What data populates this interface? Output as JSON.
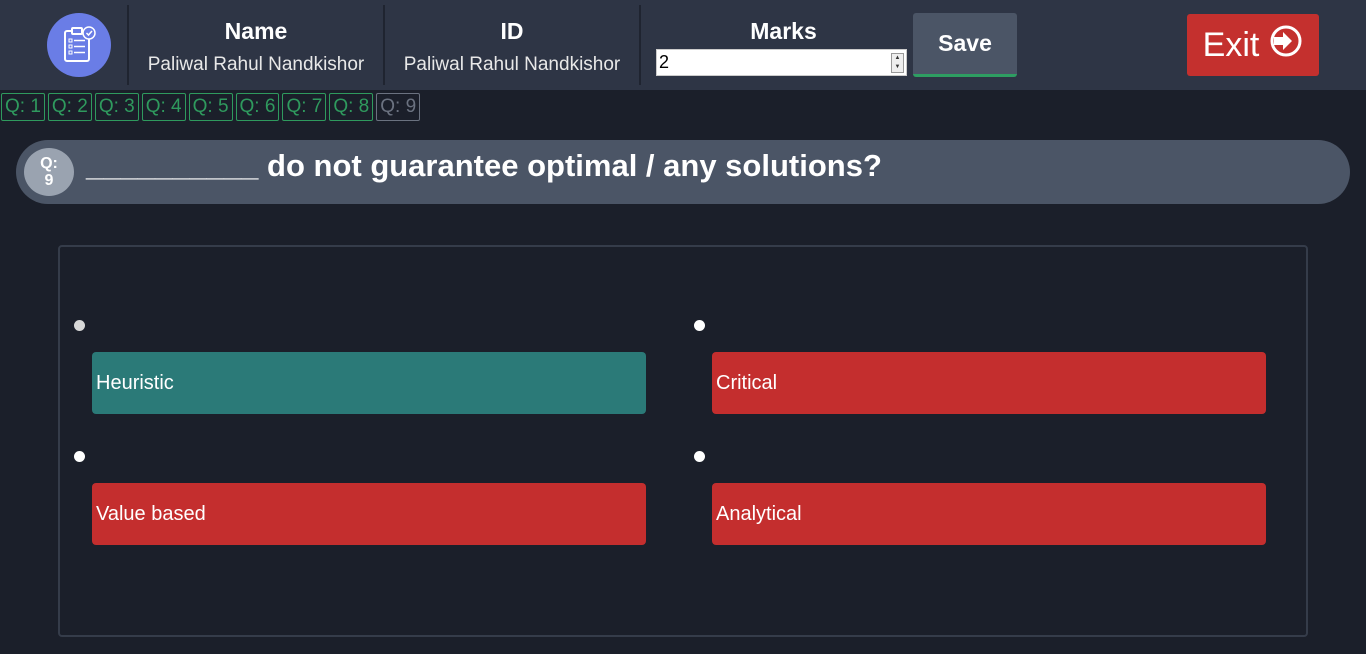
{
  "header": {
    "name_label": "Name",
    "name_value": "Paliwal Rahul Nandkishor",
    "id_label": "ID",
    "id_value": "Paliwal Rahul Nandkishor",
    "marks_label": "Marks",
    "marks_value": "2",
    "save_label": "Save",
    "exit_label": "Exit"
  },
  "nav": {
    "questions": [
      "Q: 1",
      "Q: 2",
      "Q: 3",
      "Q: 4",
      "Q: 5",
      "Q: 6",
      "Q: 7",
      "Q: 8",
      "Q: 9"
    ],
    "current": "Q: 9"
  },
  "question": {
    "badge_prefix": "Q:",
    "badge_number": "9",
    "text": "__________ do not guarantee optimal / any solutions?"
  },
  "options": [
    {
      "label": "Heuristic",
      "state": "correct"
    },
    {
      "label": "Critical",
      "state": "wrong"
    },
    {
      "label": "Value based",
      "state": "wrong"
    },
    {
      "label": "Analytical",
      "state": "wrong"
    }
  ],
  "colors": {
    "background": "#1b1f2a",
    "topbar": "#2e3545",
    "accent_green": "#2f9a5e",
    "correct_option": "#2b7a78",
    "wrong_option": "#c42e2e",
    "exit_button": "#c4302e",
    "logo": "#6a7de6"
  },
  "icons": {
    "logo": "quiz-clipboard-icon",
    "exit": "sign-in-arrow-icon"
  }
}
